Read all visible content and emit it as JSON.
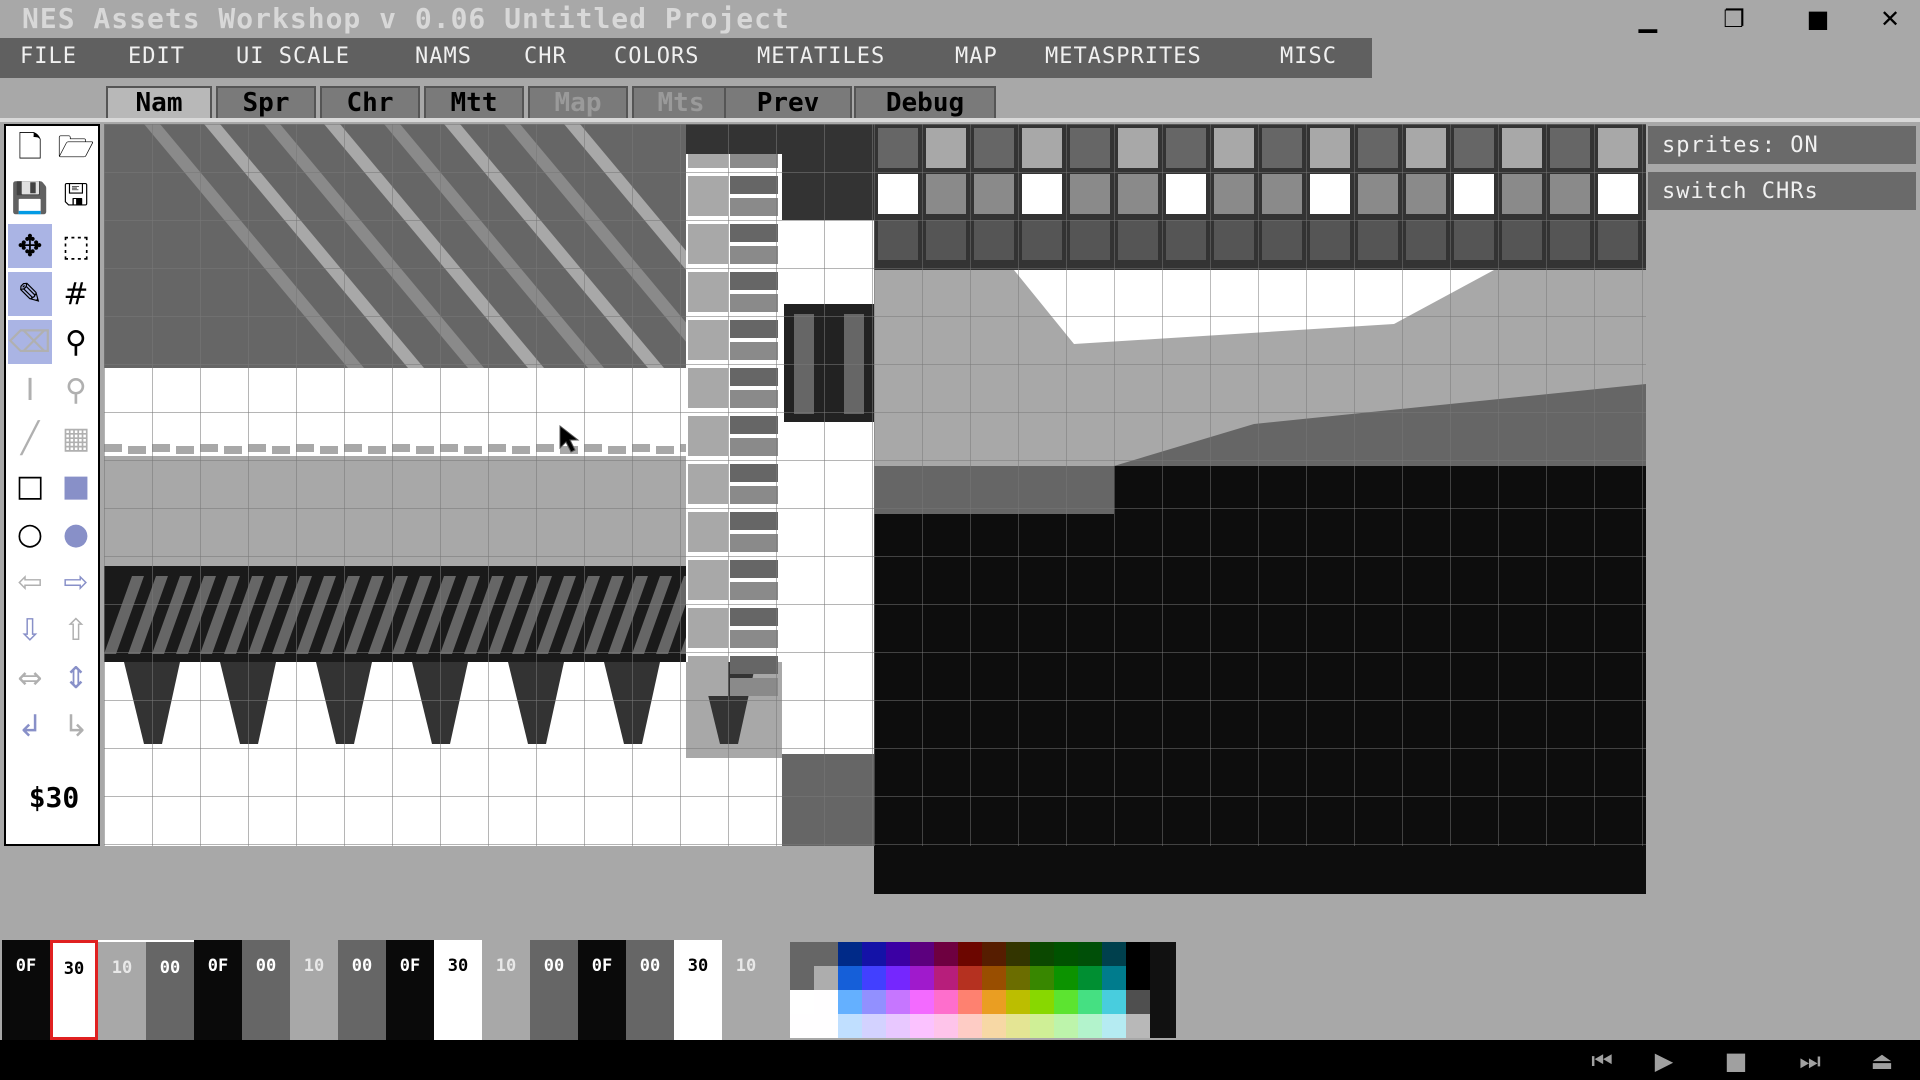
{
  "window": {
    "title": "NES Assets Workshop v 0.06 Untitled Project",
    "minimize_icon": "minimize-icon",
    "restore_icon": "restore-icon",
    "maximize_icon": "maximize-icon",
    "close_icon": "close-icon"
  },
  "menu": {
    "items": [
      "FILE",
      "EDIT",
      "UI SCALE",
      "NAMS",
      "CHR",
      "COLORS",
      "METATILES",
      "MAP",
      "METASPRITES",
      "MISC"
    ]
  },
  "tabs": [
    {
      "label": "Nam",
      "state": "active"
    },
    {
      "label": "Spr",
      "state": "normal"
    },
    {
      "label": "Chr",
      "state": "normal"
    },
    {
      "label": "Mtt",
      "state": "normal"
    },
    {
      "label": "Map",
      "state": "disabled"
    },
    {
      "label": "Mts",
      "state": "disabled"
    },
    {
      "label": "Prev",
      "state": "normal"
    },
    {
      "label": "Debug",
      "state": "normal"
    }
  ],
  "tools": [
    {
      "icon": "new-file-icon",
      "selected": false,
      "dim": false
    },
    {
      "icon": "open-folder-icon",
      "selected": false,
      "dim": false
    },
    {
      "icon": "save-icon",
      "selected": false,
      "dim": false
    },
    {
      "icon": "save-as-icon",
      "selected": false,
      "dim": false
    },
    {
      "icon": "move-icon",
      "selected": true,
      "dim": false
    },
    {
      "icon": "select-rect-icon",
      "selected": false,
      "dim": false
    },
    {
      "icon": "pencil-icon",
      "selected": true,
      "dim": false
    },
    {
      "icon": "grid-icon",
      "selected": false,
      "dim": false
    },
    {
      "icon": "eraser-icon",
      "selected": true,
      "dim": true
    },
    {
      "icon": "eyedropper-icon",
      "selected": false,
      "dim": false
    },
    {
      "icon": "text-cursor-icon",
      "selected": false,
      "dim": true
    },
    {
      "icon": "zoom-icon",
      "selected": false,
      "dim": true
    },
    {
      "icon": "line-icon",
      "selected": false,
      "dim": true
    },
    {
      "icon": "pattern-icon",
      "selected": false,
      "dim": true
    },
    {
      "icon": "rect-outline-icon",
      "selected": false,
      "dim": false
    },
    {
      "icon": "rect-fill-icon",
      "selected": false,
      "dim": false
    },
    {
      "icon": "circle-outline-icon",
      "selected": false,
      "dim": false
    },
    {
      "icon": "circle-fill-icon",
      "selected": false,
      "dim": false
    },
    {
      "icon": "arrow-left-icon",
      "selected": false,
      "dim": true
    },
    {
      "icon": "arrow-right-icon",
      "selected": false,
      "dim": false
    },
    {
      "icon": "arrow-down-icon",
      "selected": false,
      "dim": false
    },
    {
      "icon": "arrow-up-icon",
      "selected": false,
      "dim": true
    },
    {
      "icon": "flip-horizontal-icon",
      "selected": false,
      "dim": true
    },
    {
      "icon": "flip-vertical-icon",
      "selected": false,
      "dim": false
    },
    {
      "icon": "rotate-ccw-icon",
      "selected": false,
      "dim": false
    },
    {
      "icon": "rotate-cw-icon",
      "selected": false,
      "dim": true
    }
  ],
  "current_color": "$30",
  "side_buttons": [
    "sprites: ON",
    "switch CHRs"
  ],
  "palette": {
    "entries": [
      "0F",
      "30",
      "10",
      "00",
      "0F",
      "00",
      "10",
      "00",
      "0F",
      "30",
      "10",
      "00",
      "0F",
      "00",
      "30",
      "10"
    ],
    "colors": {
      "0F": "#0a0a0a",
      "30": "#ffffff",
      "10": "#a8a8a8",
      "00": "#666666"
    },
    "selected_index": 1
  },
  "nes_palette_rows": [
    [
      "#666666",
      "#002a88",
      "#1412a7",
      "#3b00a4",
      "#5c007e",
      "#6e0040",
      "#6c0600",
      "#561d00",
      "#333500",
      "#0b4800",
      "#005200",
      "#004f08",
      "#00404d",
      "#000000"
    ],
    [
      "#adadad",
      "#155fd9",
      "#4240ff",
      "#7527fe",
      "#a01acc",
      "#b71e7b",
      "#b53120",
      "#994e00",
      "#6b6d00",
      "#388700",
      "#0c9300",
      "#008f32",
      "#007c8d",
      "#000000"
    ],
    [
      "#fffeff",
      "#64b0ff",
      "#9290ff",
      "#c676ff",
      "#f36aff",
      "#fe6ecc",
      "#fe8170",
      "#ea9e22",
      "#bcbe00",
      "#88d800",
      "#5ce430",
      "#45e082",
      "#48cdde",
      "#4f4f4f"
    ],
    [
      "#fffeff",
      "#c0dfff",
      "#d3d2ff",
      "#e8c8ff",
      "#fbc2ff",
      "#fec4ea",
      "#feccc5",
      "#f7d8a5",
      "#e4e594",
      "#cfef96",
      "#bdf4ab",
      "#b3f3cc",
      "#b5ebf2",
      "#b8b8b8"
    ]
  ],
  "transport": {
    "first_icon": "skip-back-icon",
    "play_icon": "play-icon",
    "stop_icon": "stop-icon",
    "last_icon": "skip-forward-icon",
    "eject_icon": "eject-icon"
  }
}
